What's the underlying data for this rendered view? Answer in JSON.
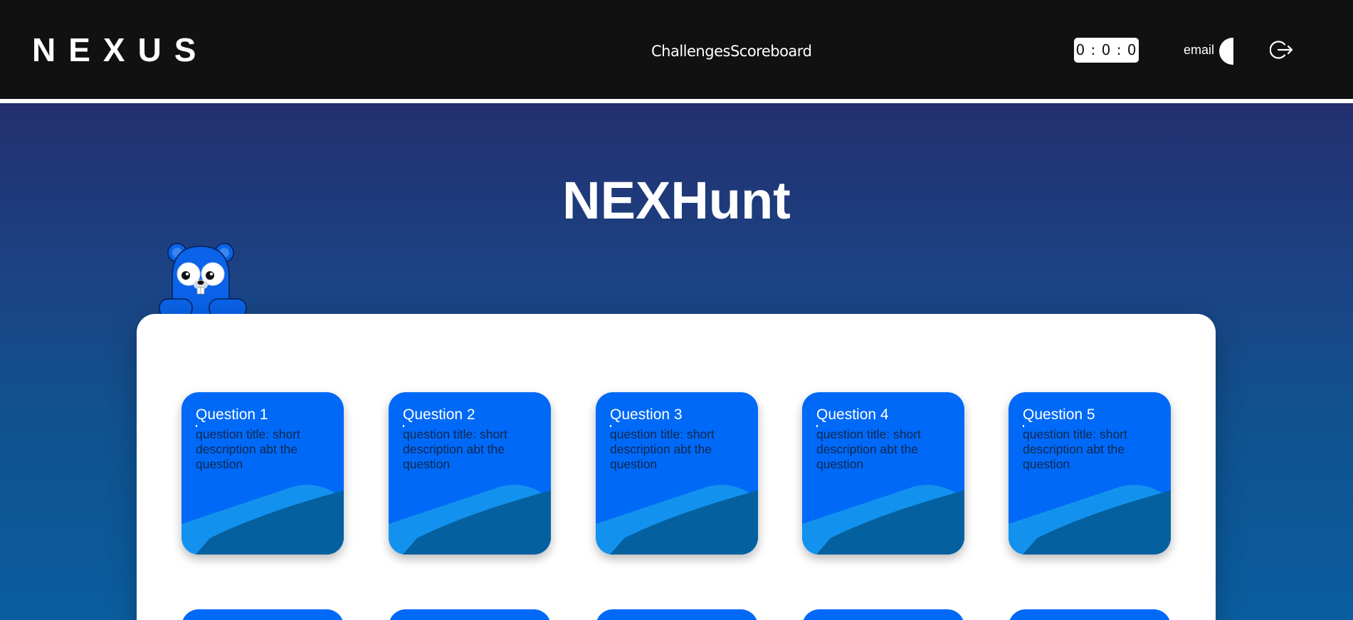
{
  "navbar": {
    "brand": "NEXUS",
    "links": [
      "Challenges",
      "Scoreboard"
    ],
    "timer": "0 : 0 : 0",
    "email_label": "email"
  },
  "hero": {
    "title": "NEXHunt"
  },
  "questions": [
    {
      "title": "Question 1",
      "description": "question title: short description abt the question"
    },
    {
      "title": "Question 2",
      "description": "question title: short description abt the question"
    },
    {
      "title": "Question 3",
      "description": "question title: short description abt the question"
    },
    {
      "title": "Question 4",
      "description": "question title: short description abt the question"
    },
    {
      "title": "Question 5",
      "description": "question title: short description abt the question"
    }
  ],
  "colors": {
    "navbar_bg": "#111111",
    "card_blue": "#0069f7",
    "wave_light": "#1292ee",
    "wave_dark": "#05609f",
    "hero_top": "#232f6e",
    "hero_bottom": "#0a5d9f"
  },
  "icons": {
    "logout": "logout-icon",
    "theme_toggle": "theme-toggle-icon"
  }
}
